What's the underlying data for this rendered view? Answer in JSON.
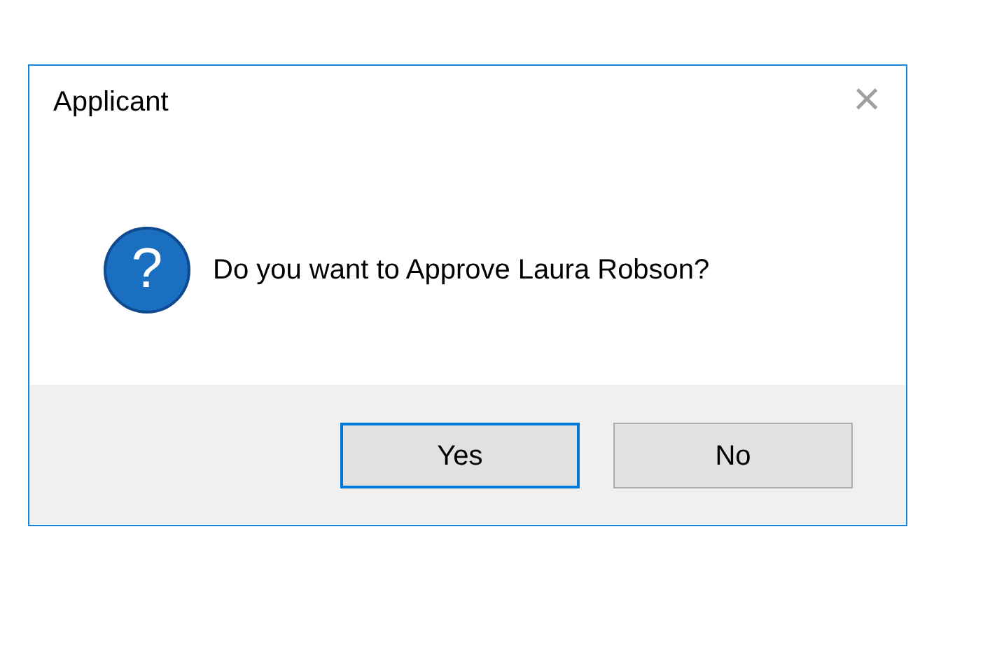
{
  "window": {
    "title": "Applicant",
    "close": "×"
  },
  "message": {
    "text": "Do you want to Approve Laura Robson?",
    "icon_glyph": "?"
  },
  "buttons": [
    {
      "label": "Yes",
      "default": true
    },
    {
      "label": "No",
      "default": false
    }
  ]
}
